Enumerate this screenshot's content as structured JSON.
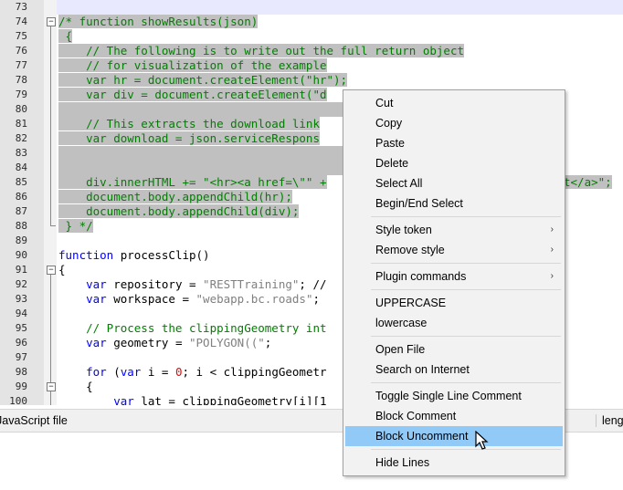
{
  "editor": {
    "lines": [
      {
        "n": "73"
      },
      {
        "n": "74"
      },
      {
        "n": "75"
      },
      {
        "n": "76"
      },
      {
        "n": "77"
      },
      {
        "n": "78"
      },
      {
        "n": "79"
      },
      {
        "n": "80"
      },
      {
        "n": "81"
      },
      {
        "n": "82"
      },
      {
        "n": "83"
      },
      {
        "n": "84"
      },
      {
        "n": "85"
      },
      {
        "n": "86"
      },
      {
        "n": "87"
      },
      {
        "n": "88"
      },
      {
        "n": "89"
      },
      {
        "n": "90"
      },
      {
        "n": "91"
      },
      {
        "n": "92"
      },
      {
        "n": "93"
      },
      {
        "n": "94"
      },
      {
        "n": "95"
      },
      {
        "n": "96"
      },
      {
        "n": "97"
      },
      {
        "n": "98"
      },
      {
        "n": "99"
      },
      {
        "n": "100"
      }
    ],
    "code": {
      "l74": "/* function showResults(json)",
      "l75": " {",
      "l76": "    // The following is to write out the full return object",
      "l77": "    // for visualization of the example",
      "l78": "    var hr = document.createElement(\"hr\");",
      "l79": "    var div = document.createElement(\"d",
      "l81": "    // This extracts the download link",
      "l82": "    var download = json.serviceRespons",
      "l85a": "    div.innerHTML += \"<hr><a href=\\\"\" +",
      "l85b": "t</a>\";",
      "l86": "    document.body.appendChild(hr);",
      "l87": "    document.body.appendChild(div);",
      "l88": " } */",
      "l90_kw": "function",
      "l90_rest": " processClip()",
      "l91": "{",
      "l92_kw": "    var",
      "l92_a": " repository = ",
      "l92_s": "\"RESTTraining\"",
      "l92_b": "; //",
      "l93_kw": "    var",
      "l93_a": " workspace = ",
      "l93_s": "\"webapp.bc.roads\"",
      "l93_b": ";",
      "l95": "    // Process the clippingGeometry int",
      "l96_kw": "    var",
      "l96_a": " geometry = ",
      "l96_s": "\"POLYGON((\"",
      "l96_b": ";",
      "l98_kw1": "    for",
      "l98_a": " (",
      "l98_kw2": "var",
      "l98_b": " i = ",
      "l98_n": "0",
      "l98_c": "; i < clippingGeometr",
      "l99": "    {",
      "l100_kw": "        var",
      "l100_a": " lat = clippingGeometry[i][1"
    }
  },
  "status": {
    "file_type": "JavaScript file",
    "right": "leng"
  },
  "context_menu": {
    "items": [
      {
        "label": "Cut"
      },
      {
        "label": "Copy"
      },
      {
        "label": "Paste"
      },
      {
        "label": "Delete"
      },
      {
        "label": "Select All"
      },
      {
        "label": "Begin/End Select"
      },
      {
        "label": "Style token"
      },
      {
        "label": "Remove style"
      },
      {
        "label": "Plugin commands"
      },
      {
        "label": "UPPERCASE"
      },
      {
        "label": "lowercase"
      },
      {
        "label": "Open File"
      },
      {
        "label": "Search on Internet"
      },
      {
        "label": "Toggle Single Line Comment"
      },
      {
        "label": "Block Comment"
      },
      {
        "label": "Block Uncomment"
      },
      {
        "label": "Hide Lines"
      }
    ],
    "submenu_arrow": "›"
  },
  "colors": {
    "comment": "#008000",
    "keyword": "#0000ff",
    "string": "#808080",
    "selection": "#c0c0c0",
    "menu_highlight": "#91c9f7"
  }
}
